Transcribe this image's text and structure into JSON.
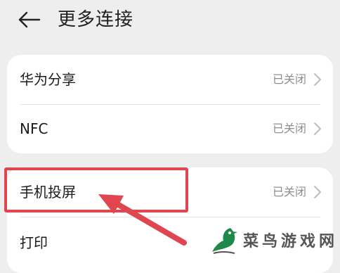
{
  "header": {
    "back_icon": "arrow-left-icon",
    "title": "更多连接"
  },
  "groups": [
    {
      "items": [
        {
          "label": "华为分享",
          "status": "已关闭"
        },
        {
          "label": "NFC",
          "status": "已关闭"
        }
      ]
    },
    {
      "items": [
        {
          "label": "手机投屏",
          "status": "已关闭"
        },
        {
          "label": "打印",
          "status": ""
        }
      ]
    }
  ],
  "annotation": {
    "highlight_color": "#e0464f",
    "highlighted_item": "手机投屏"
  },
  "watermark": {
    "text": "菜鸟游戏网",
    "logo_color": "#1e8a4a",
    "icon": "bird-logo-icon"
  },
  "colors": {
    "background": "#eeeeee",
    "card": "#ffffff",
    "status_text": "#8d8d8d"
  }
}
